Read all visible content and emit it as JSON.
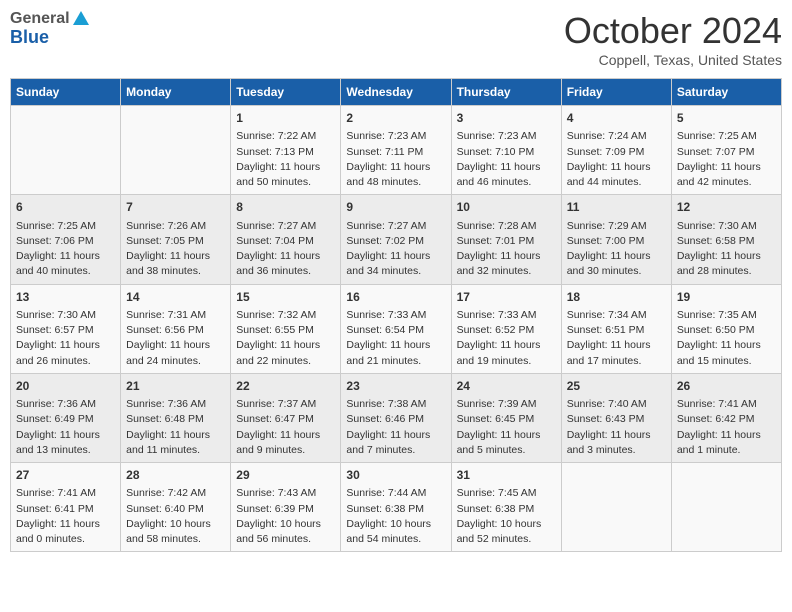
{
  "header": {
    "logo_general": "General",
    "logo_blue": "Blue",
    "month": "October 2024",
    "location": "Coppell, Texas, United States"
  },
  "days_of_week": [
    "Sunday",
    "Monday",
    "Tuesday",
    "Wednesday",
    "Thursday",
    "Friday",
    "Saturday"
  ],
  "weeks": [
    [
      {
        "day": "",
        "content": ""
      },
      {
        "day": "",
        "content": ""
      },
      {
        "day": "1",
        "content": "Sunrise: 7:22 AM\nSunset: 7:13 PM\nDaylight: 11 hours and 50 minutes."
      },
      {
        "day": "2",
        "content": "Sunrise: 7:23 AM\nSunset: 7:11 PM\nDaylight: 11 hours and 48 minutes."
      },
      {
        "day": "3",
        "content": "Sunrise: 7:23 AM\nSunset: 7:10 PM\nDaylight: 11 hours and 46 minutes."
      },
      {
        "day": "4",
        "content": "Sunrise: 7:24 AM\nSunset: 7:09 PM\nDaylight: 11 hours and 44 minutes."
      },
      {
        "day": "5",
        "content": "Sunrise: 7:25 AM\nSunset: 7:07 PM\nDaylight: 11 hours and 42 minutes."
      }
    ],
    [
      {
        "day": "6",
        "content": "Sunrise: 7:25 AM\nSunset: 7:06 PM\nDaylight: 11 hours and 40 minutes."
      },
      {
        "day": "7",
        "content": "Sunrise: 7:26 AM\nSunset: 7:05 PM\nDaylight: 11 hours and 38 minutes."
      },
      {
        "day": "8",
        "content": "Sunrise: 7:27 AM\nSunset: 7:04 PM\nDaylight: 11 hours and 36 minutes."
      },
      {
        "day": "9",
        "content": "Sunrise: 7:27 AM\nSunset: 7:02 PM\nDaylight: 11 hours and 34 minutes."
      },
      {
        "day": "10",
        "content": "Sunrise: 7:28 AM\nSunset: 7:01 PM\nDaylight: 11 hours and 32 minutes."
      },
      {
        "day": "11",
        "content": "Sunrise: 7:29 AM\nSunset: 7:00 PM\nDaylight: 11 hours and 30 minutes."
      },
      {
        "day": "12",
        "content": "Sunrise: 7:30 AM\nSunset: 6:58 PM\nDaylight: 11 hours and 28 minutes."
      }
    ],
    [
      {
        "day": "13",
        "content": "Sunrise: 7:30 AM\nSunset: 6:57 PM\nDaylight: 11 hours and 26 minutes."
      },
      {
        "day": "14",
        "content": "Sunrise: 7:31 AM\nSunset: 6:56 PM\nDaylight: 11 hours and 24 minutes."
      },
      {
        "day": "15",
        "content": "Sunrise: 7:32 AM\nSunset: 6:55 PM\nDaylight: 11 hours and 22 minutes."
      },
      {
        "day": "16",
        "content": "Sunrise: 7:33 AM\nSunset: 6:54 PM\nDaylight: 11 hours and 21 minutes."
      },
      {
        "day": "17",
        "content": "Sunrise: 7:33 AM\nSunset: 6:52 PM\nDaylight: 11 hours and 19 minutes."
      },
      {
        "day": "18",
        "content": "Sunrise: 7:34 AM\nSunset: 6:51 PM\nDaylight: 11 hours and 17 minutes."
      },
      {
        "day": "19",
        "content": "Sunrise: 7:35 AM\nSunset: 6:50 PM\nDaylight: 11 hours and 15 minutes."
      }
    ],
    [
      {
        "day": "20",
        "content": "Sunrise: 7:36 AM\nSunset: 6:49 PM\nDaylight: 11 hours and 13 minutes."
      },
      {
        "day": "21",
        "content": "Sunrise: 7:36 AM\nSunset: 6:48 PM\nDaylight: 11 hours and 11 minutes."
      },
      {
        "day": "22",
        "content": "Sunrise: 7:37 AM\nSunset: 6:47 PM\nDaylight: 11 hours and 9 minutes."
      },
      {
        "day": "23",
        "content": "Sunrise: 7:38 AM\nSunset: 6:46 PM\nDaylight: 11 hours and 7 minutes."
      },
      {
        "day": "24",
        "content": "Sunrise: 7:39 AM\nSunset: 6:45 PM\nDaylight: 11 hours and 5 minutes."
      },
      {
        "day": "25",
        "content": "Sunrise: 7:40 AM\nSunset: 6:43 PM\nDaylight: 11 hours and 3 minutes."
      },
      {
        "day": "26",
        "content": "Sunrise: 7:41 AM\nSunset: 6:42 PM\nDaylight: 11 hours and 1 minute."
      }
    ],
    [
      {
        "day": "27",
        "content": "Sunrise: 7:41 AM\nSunset: 6:41 PM\nDaylight: 11 hours and 0 minutes."
      },
      {
        "day": "28",
        "content": "Sunrise: 7:42 AM\nSunset: 6:40 PM\nDaylight: 10 hours and 58 minutes."
      },
      {
        "day": "29",
        "content": "Sunrise: 7:43 AM\nSunset: 6:39 PM\nDaylight: 10 hours and 56 minutes."
      },
      {
        "day": "30",
        "content": "Sunrise: 7:44 AM\nSunset: 6:38 PM\nDaylight: 10 hours and 54 minutes."
      },
      {
        "day": "31",
        "content": "Sunrise: 7:45 AM\nSunset: 6:38 PM\nDaylight: 10 hours and 52 minutes."
      },
      {
        "day": "",
        "content": ""
      },
      {
        "day": "",
        "content": ""
      }
    ]
  ]
}
